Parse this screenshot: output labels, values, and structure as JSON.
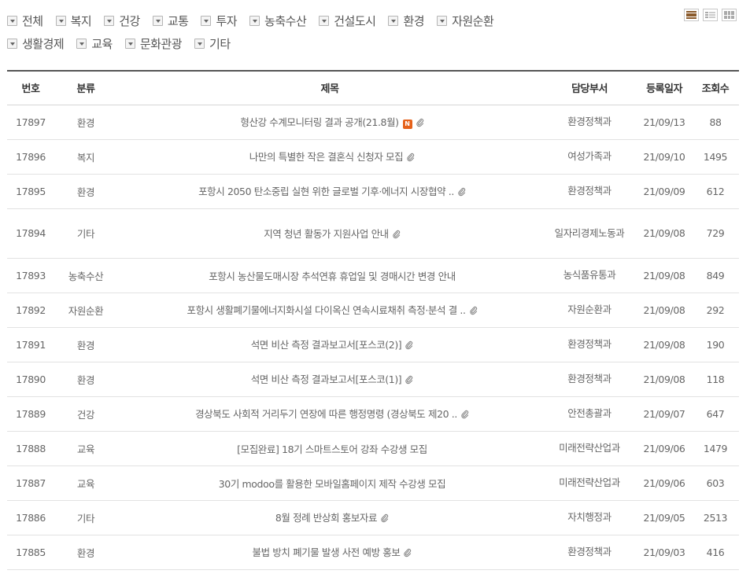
{
  "categories": {
    "row1": [
      {
        "label": "전체",
        "name": "filter-all"
      },
      {
        "label": "복지",
        "name": "filter-welfare"
      },
      {
        "label": "건강",
        "name": "filter-health"
      },
      {
        "label": "교통",
        "name": "filter-traffic"
      },
      {
        "label": "투자",
        "name": "filter-investment"
      },
      {
        "label": "농축수산",
        "name": "filter-agriculture"
      },
      {
        "label": "건설도시",
        "name": "filter-construction"
      },
      {
        "label": "환경",
        "name": "filter-environment"
      },
      {
        "label": "자원순환",
        "name": "filter-recycling"
      }
    ],
    "row2": [
      {
        "label": "생활경제",
        "name": "filter-living-economy"
      },
      {
        "label": "교육",
        "name": "filter-education"
      },
      {
        "label": "문화관광",
        "name": "filter-culture-tourism"
      },
      {
        "label": "기타",
        "name": "filter-etc"
      }
    ]
  },
  "view_modes": [
    "list-view-icon",
    "summary-view-icon",
    "grid-view-icon"
  ],
  "table": {
    "headers": {
      "no": "번호",
      "category": "분류",
      "title": "제목",
      "dept": "담당부서",
      "date": "등록일자",
      "views": "조회수"
    },
    "rows": [
      {
        "no": "17897",
        "category": "환경",
        "title": "형산강 수계모니터링 결과 공개(21.8월)",
        "is_new": true,
        "attach": true,
        "dept": "환경정책과",
        "date": "21/09/13",
        "views": "88"
      },
      {
        "no": "17896",
        "category": "복지",
        "title": "나만의 특별한 작은 결혼식 신청자 모집",
        "is_new": false,
        "attach": true,
        "dept": "여성가족과",
        "date": "21/09/10",
        "views": "1495"
      },
      {
        "no": "17895",
        "category": "환경",
        "title": "포항시 2050 탄소중립 실현 위한 글로벌 기후·에너지 시장협약 ..",
        "is_new": false,
        "attach": true,
        "dept": "환경정책과",
        "date": "21/09/09",
        "views": "612"
      },
      {
        "no": "17894",
        "category": "기타",
        "title": "지역 청년 활동가 지원사업 안내",
        "is_new": false,
        "attach": true,
        "dept": "일자리경제노동과",
        "date": "21/09/08",
        "views": "729"
      },
      {
        "no": "17893",
        "category": "농축수산",
        "title": "포항시 농산물도매시장 추석연휴 휴업일 및 경매시간 변경 안내",
        "is_new": false,
        "attach": false,
        "dept": "농식품유통과",
        "date": "21/09/08",
        "views": "849"
      },
      {
        "no": "17892",
        "category": "자원순환",
        "title": "포항시 생활폐기물에너지화시설 다이옥신 연속시료채취 측정·분석 결 ..",
        "is_new": false,
        "attach": true,
        "dept": "자원순환과",
        "date": "21/09/08",
        "views": "292"
      },
      {
        "no": "17891",
        "category": "환경",
        "title": "석면 비산 측정 결과보고서[포스코(2)]",
        "is_new": false,
        "attach": true,
        "dept": "환경정책과",
        "date": "21/09/08",
        "views": "190"
      },
      {
        "no": "17890",
        "category": "환경",
        "title": "석면 비산 측정 결과보고서[포스코(1)]",
        "is_new": false,
        "attach": true,
        "dept": "환경정책과",
        "date": "21/09/08",
        "views": "118"
      },
      {
        "no": "17889",
        "category": "건강",
        "title": "경상북도 사회적 거리두기 연장에 따른 행정명령 (경상북도 제20 ..",
        "is_new": false,
        "attach": true,
        "dept": "안전총괄과",
        "date": "21/09/07",
        "views": "647"
      },
      {
        "no": "17888",
        "category": "교육",
        "title": "[모집완료] 18기 스마트스토어 강좌 수강생 모집",
        "is_new": false,
        "attach": false,
        "dept": "미래전략산업과",
        "date": "21/09/06",
        "views": "1479"
      },
      {
        "no": "17887",
        "category": "교육",
        "title": "30기 modoo를 활용한 모바일홈페이지 제작 수강생 모집",
        "is_new": false,
        "attach": false,
        "dept": "미래전략산업과",
        "date": "21/09/06",
        "views": "603"
      },
      {
        "no": "17886",
        "category": "기타",
        "title": "8월 정례 반상회 홍보자료",
        "is_new": false,
        "attach": true,
        "dept": "자치행정과",
        "date": "21/09/05",
        "views": "2513"
      },
      {
        "no": "17885",
        "category": "환경",
        "title": "불법 방치 폐기물 발생 사전 예방 홍보",
        "is_new": false,
        "attach": true,
        "dept": "환경정책과",
        "date": "21/09/03",
        "views": "416"
      }
    ]
  },
  "badges": {
    "new_label": "N"
  },
  "colors": {
    "new_badge": "#e5611a",
    "list_icon_active": "#8a5a2b",
    "header_border": "#555555"
  }
}
